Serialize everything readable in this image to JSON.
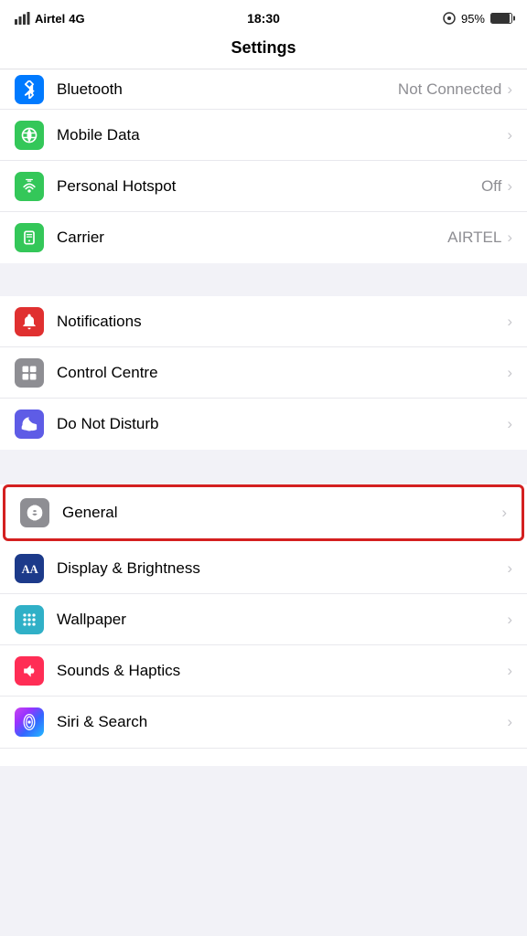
{
  "statusBar": {
    "carrier": "Airtel",
    "network": "4G",
    "time": "18:30",
    "batteryPercent": "95%",
    "locationIcon": "⊕"
  },
  "navTitle": "Settings",
  "groups": [
    {
      "id": "connectivity",
      "rows": [
        {
          "id": "bluetooth",
          "icon": "bluetooth",
          "iconColor": "blue",
          "label": "Bluetooth",
          "value": "Not Connected",
          "partial": true
        },
        {
          "id": "mobile-data",
          "icon": "mobile-data",
          "iconColor": "green",
          "label": "Mobile Data",
          "value": "",
          "chevron": "›"
        },
        {
          "id": "personal-hotspot",
          "icon": "hotspot",
          "iconColor": "green",
          "label": "Personal Hotspot",
          "value": "Off",
          "chevron": "›"
        },
        {
          "id": "carrier",
          "icon": "carrier",
          "iconColor": "green",
          "label": "Carrier",
          "value": "AIRTEL",
          "chevron": "›"
        }
      ]
    },
    {
      "id": "system",
      "rows": [
        {
          "id": "notifications",
          "icon": "notifications",
          "iconColor": "red",
          "label": "Notifications",
          "value": "",
          "chevron": "›"
        },
        {
          "id": "control-centre",
          "icon": "control-centre",
          "iconColor": "gray",
          "label": "Control Centre",
          "value": "",
          "chevron": "›"
        },
        {
          "id": "do-not-disturb",
          "icon": "do-not-disturb",
          "iconColor": "purple-dark",
          "label": "Do Not Disturb",
          "value": "",
          "chevron": "›"
        }
      ]
    },
    {
      "id": "general-group",
      "rows": [
        {
          "id": "general",
          "icon": "general",
          "iconColor": "gray",
          "label": "General",
          "value": "",
          "chevron": "›",
          "highlighted": true
        },
        {
          "id": "display-brightness",
          "icon": "display",
          "iconColor": "navy",
          "label": "Display & Brightness",
          "value": "",
          "chevron": "›"
        },
        {
          "id": "wallpaper",
          "icon": "wallpaper",
          "iconColor": "teal",
          "label": "Wallpaper",
          "value": "",
          "chevron": "›"
        },
        {
          "id": "sounds-haptics",
          "icon": "sounds",
          "iconColor": "pink",
          "label": "Sounds & Haptics",
          "value": "",
          "chevron": "›"
        },
        {
          "id": "siri-search",
          "icon": "siri",
          "iconColor": "gradient-siri",
          "label": "Siri & Search",
          "value": "",
          "chevron": "›"
        }
      ]
    }
  ]
}
